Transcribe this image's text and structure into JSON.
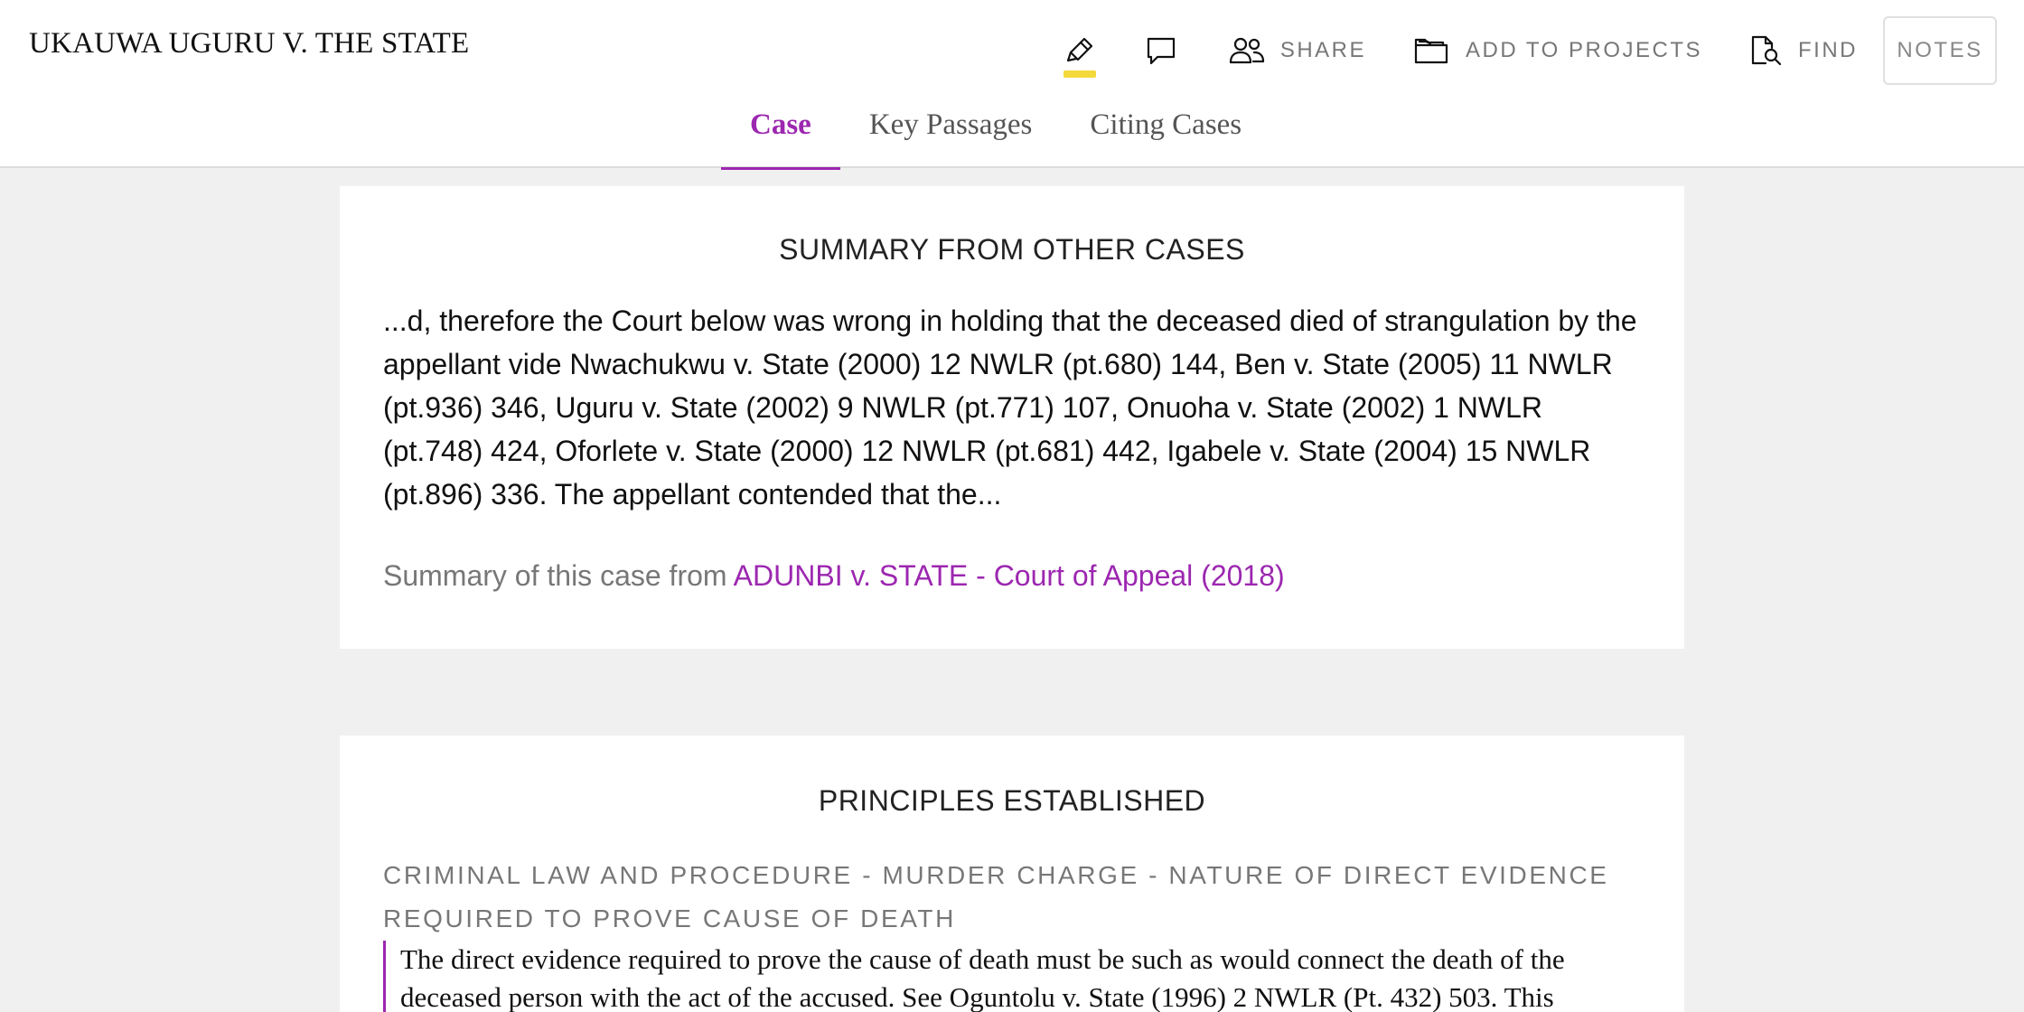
{
  "header": {
    "title": "UKAUWA UGURU V. THE STATE",
    "toolbar": {
      "highlight_icon": "highlighter-icon",
      "comment_icon": "comment-icon",
      "share_label": "SHARE",
      "projects_label": "ADD TO PROJECTS",
      "find_label": "FIND",
      "notes_label": "NOTES"
    },
    "tabs": [
      {
        "label": "Case",
        "active": true
      },
      {
        "label": "Key Passages",
        "active": false
      },
      {
        "label": "Citing Cases",
        "active": false
      }
    ]
  },
  "colors": {
    "accent": "#9c27b0",
    "highlight": "#f4d93b",
    "background": "#f0f0f0"
  },
  "summary": {
    "heading": "SUMMARY FROM OTHER CASES",
    "text": "...d, therefore the Court below was wrong in holding that the deceased died of strangulation by the appellant vide Nwachukwu v. State (2000) 12 NWLR (pt.680) 144, Ben v. State (2005) 11 NWLR (pt.936) 346, Uguru v. State (2002) 9 NWLR (pt.771) 107, Onuoha v. State (2002) 1 NWLR (pt.748) 424, Oforlete v. State (2000) 12 NWLR (pt.681) 442, Igabele v. State (2004) 15 NWLR (pt.896) 336. The appellant contended that the...",
    "source_prefix": "Summary of this case from",
    "source_link": "ADUNBI v. STATE - Court of Appeal (2018)"
  },
  "principles": {
    "heading": "PRINCIPLES ESTABLISHED",
    "items": [
      {
        "title": "CRIMINAL LAW AND PROCEDURE - MURDER CHARGE - NATURE OF DIRECT EVIDENCE REQUIRED TO PROVE CAUSE OF DEATH",
        "text": "The direct evidence required to prove the cause of death must be such as would connect the death of the deceased person with the act of the accused. See Oguntolu v. State (1996) 2 NWLR (Pt. 432) 503. This"
      }
    ]
  }
}
